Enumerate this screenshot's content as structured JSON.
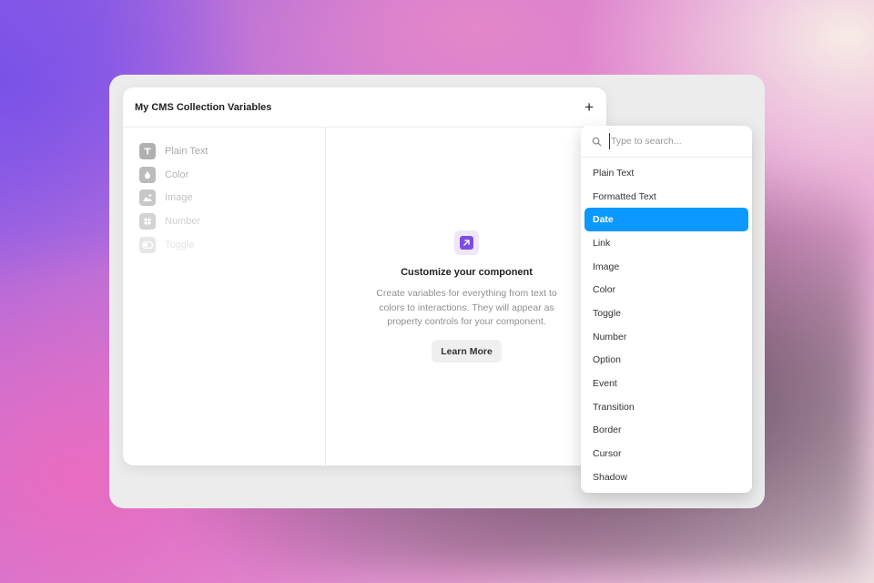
{
  "panel": {
    "title": "My CMS Collection Variables",
    "add_label": "+"
  },
  "variable_types": [
    {
      "label": "Plain Text",
      "icon": "text-icon",
      "opacity": 1.0
    },
    {
      "label": "Color",
      "icon": "droplet-icon",
      "opacity": 0.85
    },
    {
      "label": "Image",
      "icon": "image-icon",
      "opacity": 0.7
    },
    {
      "label": "Number",
      "icon": "hash-icon",
      "opacity": 0.55
    },
    {
      "label": "Toggle",
      "icon": "toggle-icon",
      "opacity": 0.3
    }
  ],
  "empty_state": {
    "icon": "arrow-up-right-icon",
    "title": "Customize your component",
    "description": "Create variables for everything from text to colors to interactions. They will appear as property controls for your component.",
    "button_label": "Learn More"
  },
  "dropdown": {
    "search_placeholder": "Type to search...",
    "selected": "Date",
    "options": [
      "Plain Text",
      "Formatted Text",
      "Date",
      "Link",
      "Image",
      "Color",
      "Toggle",
      "Number",
      "Option",
      "Event",
      "Transition",
      "Border",
      "Cursor",
      "Shadow"
    ]
  },
  "colors": {
    "accent_selection": "#0b99ff",
    "component_icon": "#7b4ee0"
  }
}
